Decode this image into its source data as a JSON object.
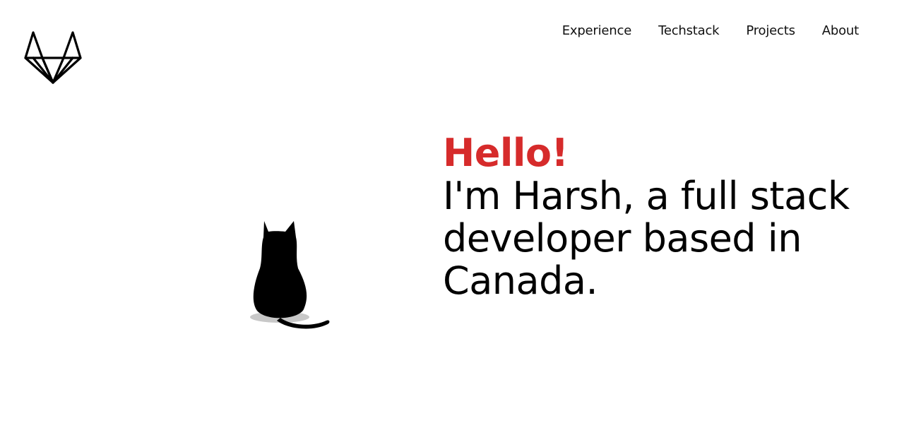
{
  "logo": {
    "icon": "fox-logo-icon"
  },
  "nav": {
    "items": [
      {
        "label": "Experience"
      },
      {
        "label": "Techstack"
      },
      {
        "label": "Projects"
      },
      {
        "label": "About"
      }
    ]
  },
  "hero": {
    "greeting": "Hello!",
    "intro": "I'm Harsh, a full stack developer based in Canada.",
    "illustration": "cat-silhouette-icon"
  },
  "colors": {
    "accent": "#d62b2b",
    "text": "#000000",
    "background": "#ffffff"
  }
}
